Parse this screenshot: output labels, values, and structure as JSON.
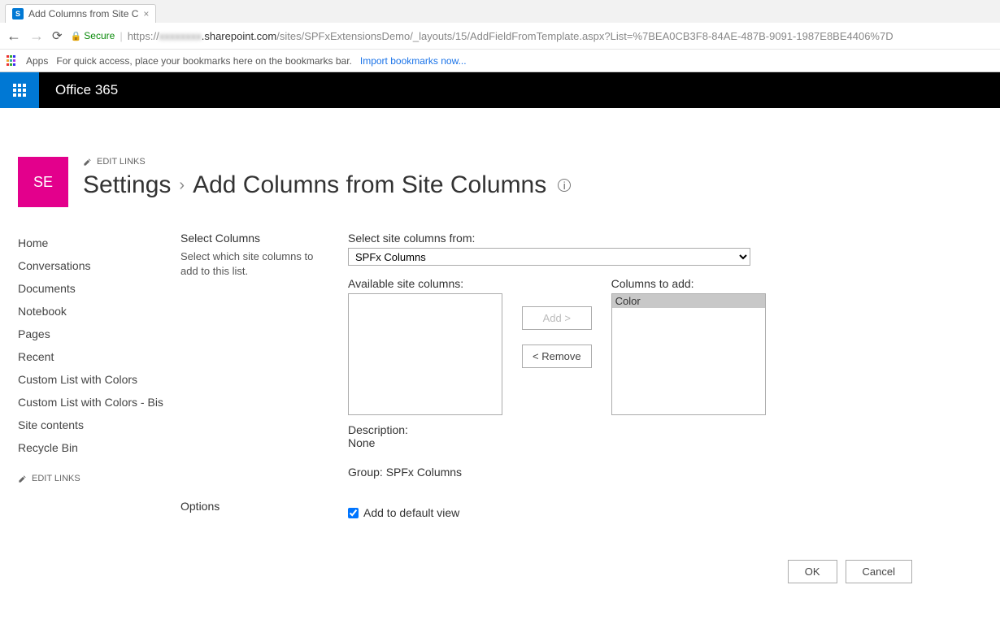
{
  "browser": {
    "tab_title": "Add Columns from Site C",
    "secure_label": "Secure",
    "url_host": ".sharepoint.com",
    "url_path": "/sites/SPFxExtensionsDemo/_layouts/15/AddFieldFromTemplate.aspx?List=%7BEA0CB3F8-84AE-487B-9091-1987E8BE4406%7D",
    "url_prefix": "https://",
    "apps_label": "Apps",
    "bookmarks_hint": "For quick access, place your bookmarks here on the bookmarks bar.",
    "import_label": "Import bookmarks now..."
  },
  "suite": {
    "title": "Office 365"
  },
  "site": {
    "logo_text": "SE",
    "edit_links_label": "EDIT LINKS",
    "breadcrumb_root": "Settings",
    "breadcrumb_page": "Add Columns from Site Columns"
  },
  "leftnav": {
    "items": [
      "Home",
      "Conversations",
      "Documents",
      "Notebook",
      "Pages",
      "Recent",
      "Custom List with Colors",
      "Custom List with Colors - Bis",
      "Site contents",
      "Recycle Bin"
    ],
    "edit_links_label": "EDIT LINKS"
  },
  "select_columns": {
    "section_title": "Select Columns",
    "section_desc": "Select which site columns to add to this list.",
    "from_label": "Select site columns from:",
    "dropdown_value": "SPFx Columns",
    "available_label": "Available site columns:",
    "toadd_label": "Columns to add:",
    "toadd_items": [
      "Color"
    ],
    "add_btn": "Add >",
    "remove_btn": "< Remove",
    "description_label": "Description:",
    "description_value": "None",
    "group_label": "Group:",
    "group_value": "SPFx Columns"
  },
  "options": {
    "section_title": "Options",
    "default_view_label": "Add to default view"
  },
  "footer": {
    "ok": "OK",
    "cancel": "Cancel"
  }
}
